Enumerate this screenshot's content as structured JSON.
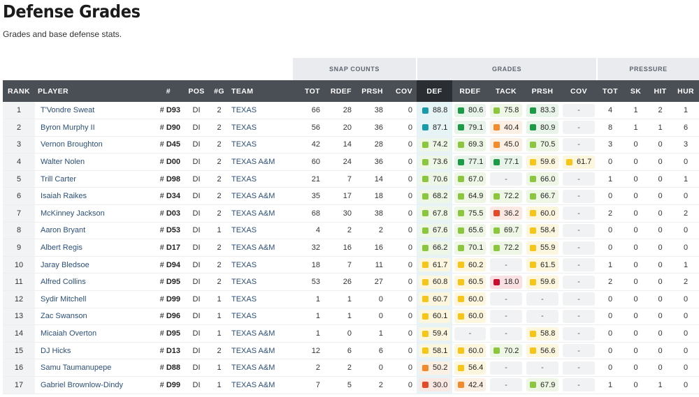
{
  "page": {
    "title": "Defense Grades",
    "subtitle": "Grades and base defense stats."
  },
  "groups": {
    "snap": "SNAP COUNTS",
    "grades": "GRADES",
    "pressure": "PRESSURE"
  },
  "columns": [
    "RANK",
    "PLAYER",
    "#",
    "POS",
    "#G",
    "TEAM",
    "TOT",
    "RDEF",
    "PRSH",
    "COV",
    "DEF",
    "RDEF",
    "TACK",
    "PRSH",
    "COV",
    "TOT",
    "SK",
    "HIT",
    "HUR"
  ],
  "colors": {
    "teal": "#1b9aaa",
    "green": "#1c9a48",
    "lime": "#8cc63f",
    "yellow": "#f5c518",
    "orange": "#f28a2e",
    "red": "#e34a2a",
    "darkred": "#c8102e"
  },
  "rows": [
    {
      "rank": "1",
      "player": "T'Vondre Sweat",
      "hash": "#",
      "num": "D93",
      "pos": "DI",
      "g": "2",
      "team": "TEXAS",
      "tot": "66",
      "rdef": "28",
      "prsh": "38",
      "cov": "0",
      "grades": [
        {
          "v": "88.8",
          "c": "#1b9aaa",
          "bg": "#e6f4f6"
        },
        {
          "v": "80.6",
          "c": "#1c9a48",
          "bg": "#e8f4ea"
        },
        {
          "v": "75.8",
          "c": "#8cc63f",
          "bg": "#eef6e6"
        },
        {
          "v": "83.3",
          "c": "#1c9a48",
          "bg": "#e8f4ea"
        },
        {
          "v": "-",
          "c": "",
          "bg": "#f1f2f4"
        }
      ],
      "ptot": "4",
      "sk": "1",
      "hit": "2",
      "hur": "1"
    },
    {
      "rank": "2",
      "player": "Byron Murphy II",
      "hash": "#",
      "num": "D90",
      "pos": "DI",
      "g": "2",
      "team": "TEXAS",
      "tot": "56",
      "rdef": "20",
      "prsh": "36",
      "cov": "0",
      "grades": [
        {
          "v": "87.1",
          "c": "#1b9aaa",
          "bg": "#e6f4f6"
        },
        {
          "v": "79.1",
          "c": "#1c9a48",
          "bg": "#e8f4ea"
        },
        {
          "v": "40.4",
          "c": "#f28a2e",
          "bg": "#fcefe4"
        },
        {
          "v": "80.9",
          "c": "#1c9a48",
          "bg": "#e8f4ea"
        },
        {
          "v": "-",
          "c": "",
          "bg": "#f1f2f4"
        }
      ],
      "ptot": "8",
      "sk": "1",
      "hit": "1",
      "hur": "6"
    },
    {
      "rank": "3",
      "player": "Vernon Broughton",
      "hash": "#",
      "num": "D45",
      "pos": "DI",
      "g": "2",
      "team": "TEXAS",
      "tot": "42",
      "rdef": "14",
      "prsh": "28",
      "cov": "0",
      "grades": [
        {
          "v": "74.2",
          "c": "#8cc63f",
          "bg": "#eef6e6"
        },
        {
          "v": "69.3",
          "c": "#8cc63f",
          "bg": "#eef6e6"
        },
        {
          "v": "45.0",
          "c": "#f28a2e",
          "bg": "#fcefe4"
        },
        {
          "v": "70.5",
          "c": "#8cc63f",
          "bg": "#eef6e6"
        },
        {
          "v": "-",
          "c": "",
          "bg": "#f1f2f4"
        }
      ],
      "ptot": "3",
      "sk": "0",
      "hit": "0",
      "hur": "3"
    },
    {
      "rank": "4",
      "player": "Walter Nolen",
      "hash": "#",
      "num": "D00",
      "pos": "DI",
      "g": "2",
      "team": "TEXAS A&M",
      "tot": "60",
      "rdef": "24",
      "prsh": "36",
      "cov": "0",
      "grades": [
        {
          "v": "73.6",
          "c": "#8cc63f",
          "bg": "#eef6e6"
        },
        {
          "v": "77.1",
          "c": "#1c9a48",
          "bg": "#e8f4ea"
        },
        {
          "v": "77.1",
          "c": "#1c9a48",
          "bg": "#e8f4ea"
        },
        {
          "v": "59.6",
          "c": "#f5c518",
          "bg": "#fcf6df"
        },
        {
          "v": "61.7",
          "c": "#f5c518",
          "bg": "#fcf6df"
        }
      ],
      "ptot": "0",
      "sk": "0",
      "hit": "0",
      "hur": "0"
    },
    {
      "rank": "5",
      "player": "Trill Carter",
      "hash": "#",
      "num": "D98",
      "pos": "DI",
      "g": "2",
      "team": "TEXAS",
      "tot": "21",
      "rdef": "7",
      "prsh": "14",
      "cov": "0",
      "grades": [
        {
          "v": "70.6",
          "c": "#8cc63f",
          "bg": "#eef6e6"
        },
        {
          "v": "67.0",
          "c": "#8cc63f",
          "bg": "#eef6e6"
        },
        {
          "v": "-",
          "c": "",
          "bg": "#f1f2f4"
        },
        {
          "v": "66.0",
          "c": "#8cc63f",
          "bg": "#eef6e6"
        },
        {
          "v": "-",
          "c": "",
          "bg": "#f1f2f4"
        }
      ],
      "ptot": "1",
      "sk": "0",
      "hit": "0",
      "hur": "1"
    },
    {
      "rank": "6",
      "player": "Isaiah Raikes",
      "hash": "#",
      "num": "D34",
      "pos": "DI",
      "g": "2",
      "team": "TEXAS A&M",
      "tot": "35",
      "rdef": "17",
      "prsh": "18",
      "cov": "0",
      "grades": [
        {
          "v": "68.2",
          "c": "#8cc63f",
          "bg": "#eef6e6"
        },
        {
          "v": "64.9",
          "c": "#8cc63f",
          "bg": "#eef6e6"
        },
        {
          "v": "72.2",
          "c": "#8cc63f",
          "bg": "#eef6e6"
        },
        {
          "v": "66.7",
          "c": "#8cc63f",
          "bg": "#eef6e6"
        },
        {
          "v": "-",
          "c": "",
          "bg": "#f1f2f4"
        }
      ],
      "ptot": "0",
      "sk": "0",
      "hit": "0",
      "hur": "0"
    },
    {
      "rank": "7",
      "player": "McKinney Jackson",
      "hash": "#",
      "num": "D03",
      "pos": "DI",
      "g": "2",
      "team": "TEXAS A&M",
      "tot": "68",
      "rdef": "30",
      "prsh": "38",
      "cov": "0",
      "grades": [
        {
          "v": "67.8",
          "c": "#8cc63f",
          "bg": "#eef6e6"
        },
        {
          "v": "75.5",
          "c": "#8cc63f",
          "bg": "#eef6e6"
        },
        {
          "v": "36.2",
          "c": "#e34a2a",
          "bg": "#fbe8e2"
        },
        {
          "v": "60.0",
          "c": "#f5c518",
          "bg": "#fcf6df"
        },
        {
          "v": "-",
          "c": "",
          "bg": "#f1f2f4"
        }
      ],
      "ptot": "2",
      "sk": "0",
      "hit": "0",
      "hur": "2"
    },
    {
      "rank": "8",
      "player": "Aaron Bryant",
      "hash": "#",
      "num": "D53",
      "pos": "DI",
      "g": "1",
      "team": "TEXAS",
      "tot": "4",
      "rdef": "2",
      "prsh": "2",
      "cov": "0",
      "grades": [
        {
          "v": "67.6",
          "c": "#8cc63f",
          "bg": "#eef6e6"
        },
        {
          "v": "65.6",
          "c": "#8cc63f",
          "bg": "#eef6e6"
        },
        {
          "v": "69.7",
          "c": "#8cc63f",
          "bg": "#eef6e6"
        },
        {
          "v": "58.4",
          "c": "#f5c518",
          "bg": "#fcf6df"
        },
        {
          "v": "-",
          "c": "",
          "bg": "#f1f2f4"
        }
      ],
      "ptot": "0",
      "sk": "0",
      "hit": "0",
      "hur": "0"
    },
    {
      "rank": "9",
      "player": "Albert Regis",
      "hash": "#",
      "num": "D17",
      "pos": "DI",
      "g": "2",
      "team": "TEXAS A&M",
      "tot": "32",
      "rdef": "16",
      "prsh": "16",
      "cov": "0",
      "grades": [
        {
          "v": "66.2",
          "c": "#8cc63f",
          "bg": "#eef6e6"
        },
        {
          "v": "70.1",
          "c": "#8cc63f",
          "bg": "#eef6e6"
        },
        {
          "v": "72.2",
          "c": "#8cc63f",
          "bg": "#eef6e6"
        },
        {
          "v": "55.9",
          "c": "#f5c518",
          "bg": "#fcf6df"
        },
        {
          "v": "-",
          "c": "",
          "bg": "#f1f2f4"
        }
      ],
      "ptot": "0",
      "sk": "0",
      "hit": "0",
      "hur": "0"
    },
    {
      "rank": "10",
      "player": "Jaray Bledsoe",
      "hash": "#",
      "num": "D94",
      "pos": "DI",
      "g": "2",
      "team": "TEXAS",
      "tot": "18",
      "rdef": "7",
      "prsh": "11",
      "cov": "0",
      "grades": [
        {
          "v": "61.7",
          "c": "#f5c518",
          "bg": "#fcf6df"
        },
        {
          "v": "60.2",
          "c": "#f5c518",
          "bg": "#fcf6df"
        },
        {
          "v": "-",
          "c": "",
          "bg": "#f1f2f4"
        },
        {
          "v": "61.5",
          "c": "#f5c518",
          "bg": "#fcf6df"
        },
        {
          "v": "-",
          "c": "",
          "bg": "#f1f2f4"
        }
      ],
      "ptot": "1",
      "sk": "0",
      "hit": "0",
      "hur": "1"
    },
    {
      "rank": "11",
      "player": "Alfred Collins",
      "hash": "#",
      "num": "D95",
      "pos": "DI",
      "g": "2",
      "team": "TEXAS",
      "tot": "53",
      "rdef": "26",
      "prsh": "27",
      "cov": "0",
      "grades": [
        {
          "v": "60.8",
          "c": "#f5c518",
          "bg": "#fcf6df"
        },
        {
          "v": "60.5",
          "c": "#f5c518",
          "bg": "#fcf6df"
        },
        {
          "v": "18.0",
          "c": "#c8102e",
          "bg": "#f9e1e3"
        },
        {
          "v": "59.6",
          "c": "#f5c518",
          "bg": "#fcf6df"
        },
        {
          "v": "-",
          "c": "",
          "bg": "#f1f2f4"
        }
      ],
      "ptot": "2",
      "sk": "0",
      "hit": "0",
      "hur": "2"
    },
    {
      "rank": "12",
      "player": "Sydir Mitchell",
      "hash": "#",
      "num": "D99",
      "pos": "DI",
      "g": "1",
      "team": "TEXAS",
      "tot": "1",
      "rdef": "1",
      "prsh": "0",
      "cov": "0",
      "grades": [
        {
          "v": "60.7",
          "c": "#f5c518",
          "bg": "#fcf6df"
        },
        {
          "v": "60.0",
          "c": "#f5c518",
          "bg": "#fcf6df"
        },
        {
          "v": "-",
          "c": "",
          "bg": "#f1f2f4"
        },
        {
          "v": "-",
          "c": "",
          "bg": "#f1f2f4"
        },
        {
          "v": "-",
          "c": "",
          "bg": "#f1f2f4"
        }
      ],
      "ptot": "0",
      "sk": "0",
      "hit": "0",
      "hur": "0"
    },
    {
      "rank": "13",
      "player": "Zac Swanson",
      "hash": "#",
      "num": "D96",
      "pos": "DI",
      "g": "1",
      "team": "TEXAS",
      "tot": "1",
      "rdef": "1",
      "prsh": "0",
      "cov": "0",
      "grades": [
        {
          "v": "60.1",
          "c": "#f5c518",
          "bg": "#fcf6df"
        },
        {
          "v": "60.0",
          "c": "#f5c518",
          "bg": "#fcf6df"
        },
        {
          "v": "-",
          "c": "",
          "bg": "#f1f2f4"
        },
        {
          "v": "-",
          "c": "",
          "bg": "#f1f2f4"
        },
        {
          "v": "-",
          "c": "",
          "bg": "#f1f2f4"
        }
      ],
      "ptot": "0",
      "sk": "0",
      "hit": "0",
      "hur": "0"
    },
    {
      "rank": "14",
      "player": "Micaiah Overton",
      "hash": "#",
      "num": "D95",
      "pos": "DI",
      "g": "1",
      "team": "TEXAS A&M",
      "tot": "1",
      "rdef": "0",
      "prsh": "1",
      "cov": "0",
      "grades": [
        {
          "v": "59.4",
          "c": "#f5c518",
          "bg": "#fcf6df"
        },
        {
          "v": "-",
          "c": "",
          "bg": "#f1f2f4"
        },
        {
          "v": "-",
          "c": "",
          "bg": "#f1f2f4"
        },
        {
          "v": "58.8",
          "c": "#f5c518",
          "bg": "#fcf6df"
        },
        {
          "v": "-",
          "c": "",
          "bg": "#f1f2f4"
        }
      ],
      "ptot": "0",
      "sk": "0",
      "hit": "0",
      "hur": "0"
    },
    {
      "rank": "15",
      "player": "DJ Hicks",
      "hash": "#",
      "num": "D13",
      "pos": "DI",
      "g": "2",
      "team": "TEXAS A&M",
      "tot": "12",
      "rdef": "6",
      "prsh": "6",
      "cov": "0",
      "grades": [
        {
          "v": "58.1",
          "c": "#f5c518",
          "bg": "#fcf6df"
        },
        {
          "v": "60.0",
          "c": "#f5c518",
          "bg": "#fcf6df"
        },
        {
          "v": "70.2",
          "c": "#8cc63f",
          "bg": "#eef6e6"
        },
        {
          "v": "56.6",
          "c": "#f5c518",
          "bg": "#fcf6df"
        },
        {
          "v": "-",
          "c": "",
          "bg": "#f1f2f4"
        }
      ],
      "ptot": "0",
      "sk": "0",
      "hit": "0",
      "hur": "0"
    },
    {
      "rank": "16",
      "player": "Samu Taumanupepe",
      "hash": "#",
      "num": "D88",
      "pos": "DI",
      "g": "1",
      "team": "TEXAS A&M",
      "tot": "2",
      "rdef": "2",
      "prsh": "0",
      "cov": "0",
      "grades": [
        {
          "v": "50.2",
          "c": "#f28a2e",
          "bg": "#fcefe4"
        },
        {
          "v": "56.4",
          "c": "#f5c518",
          "bg": "#fcf6df"
        },
        {
          "v": "-",
          "c": "",
          "bg": "#f1f2f4"
        },
        {
          "v": "-",
          "c": "",
          "bg": "#f1f2f4"
        },
        {
          "v": "-",
          "c": "",
          "bg": "#f1f2f4"
        }
      ],
      "ptot": "0",
      "sk": "0",
      "hit": "0",
      "hur": "0"
    },
    {
      "rank": "17",
      "player": "Gabriel Brownlow-Dindy",
      "hash": "#",
      "num": "D99",
      "pos": "DI",
      "g": "1",
      "team": "TEXAS A&M",
      "tot": "7",
      "rdef": "5",
      "prsh": "2",
      "cov": "0",
      "grades": [
        {
          "v": "30.0",
          "c": "#e34a2a",
          "bg": "#fbe8e2"
        },
        {
          "v": "42.4",
          "c": "#f28a2e",
          "bg": "#fcefe4"
        },
        {
          "v": "-",
          "c": "",
          "bg": "#f1f2f4"
        },
        {
          "v": "67.9",
          "c": "#8cc63f",
          "bg": "#eef6e6"
        },
        {
          "v": "-",
          "c": "",
          "bg": "#f1f2f4"
        }
      ],
      "ptot": "1",
      "sk": "0",
      "hit": "1",
      "hur": "0"
    }
  ]
}
